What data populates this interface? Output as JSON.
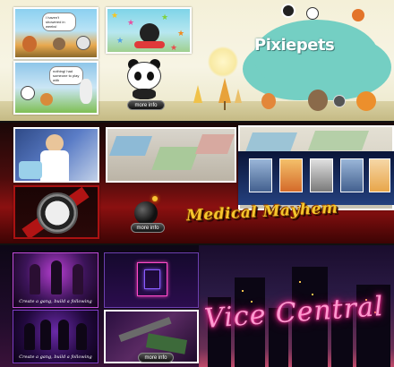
{
  "pixiepets": {
    "title": "Pixiepets",
    "more_label": "more info",
    "bubble_1": "I haven't showered in weeks!",
    "bubble_2": "nothing! had someone to play with",
    "colors": {
      "cloud": "#74cfc3",
      "ground": "#c5ba85"
    }
  },
  "medical_mayhem": {
    "title": "Medical Mayhem",
    "more_label": "more info",
    "colors": {
      "title": "#f4c62c",
      "background": "#8b1010"
    }
  },
  "vice_central": {
    "title": "Vice Central",
    "more_label": "more info",
    "caption_1": "Create a gang, build a following",
    "caption_2": "Create a gang, build a following",
    "colors": {
      "neon": "#ff2a98",
      "background": "#200c2b"
    }
  }
}
